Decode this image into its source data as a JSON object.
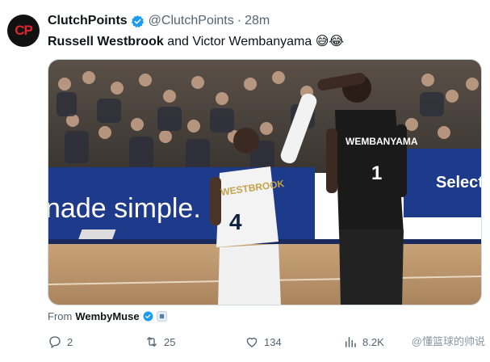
{
  "account": {
    "avatar_text": "CP",
    "name": "ClutchPoints",
    "handle": "@ClutchPoints",
    "separator": "·",
    "time": "28m"
  },
  "tweet": {
    "text_bold": "Russell Westbrook",
    "text_rest": " and Victor Wembanyama 😅😂"
  },
  "media": {
    "banner_left": "nade simple.",
    "banner_right": "Select H",
    "player1_name": "WESTBROOK",
    "player1_number": "4",
    "player2_name": "WEMBANYAMA",
    "player2_number": "1"
  },
  "source": {
    "prefix": "From",
    "user": "WembyMuse"
  },
  "actions": {
    "replies": "2",
    "retweets": "25",
    "likes": "134",
    "views": "8.2K"
  },
  "watermark": "@懂篮球的帅说"
}
